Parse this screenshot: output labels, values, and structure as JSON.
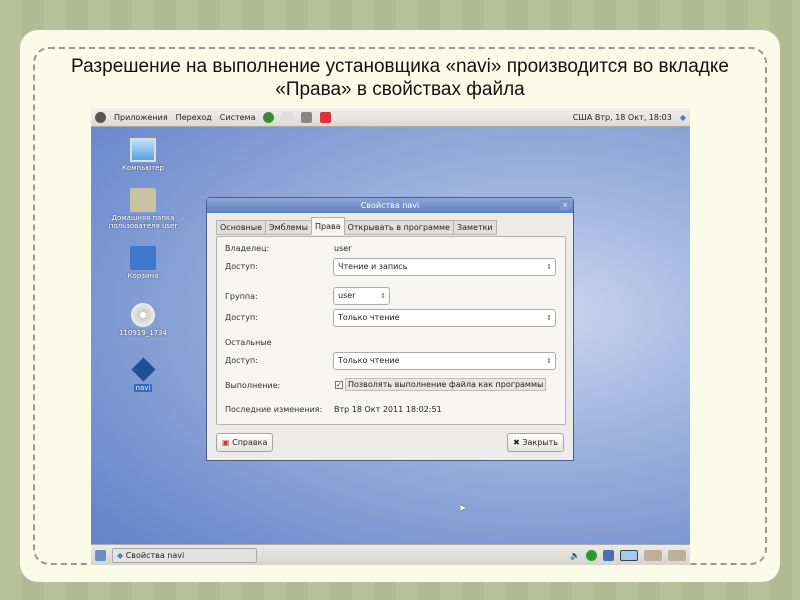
{
  "slide": {
    "title": "Разрешение на выполнение установщика «navi» производится во вкладке «Права» в свойствах файла"
  },
  "top_panel": {
    "menus": [
      "Приложения",
      "Переход",
      "Система"
    ],
    "clock": "США Втр, 18 Окт, 18:03"
  },
  "desktop_icons": [
    {
      "label": "Компьютер",
      "icon": "computer-icon"
    },
    {
      "label": "Домашняя папка пользователя user",
      "icon": "home-folder-icon"
    },
    {
      "label": "Корзина",
      "icon": "trash-icon"
    },
    {
      "label": "110919_1734",
      "icon": "cd-icon"
    },
    {
      "label": "navi",
      "icon": "installer-icon"
    }
  ],
  "dialog": {
    "title": "Свойства navi",
    "tabs": [
      "Основные",
      "Эмблемы",
      "Права",
      "Открывать в программе",
      "Заметки"
    ],
    "active_tab": "Права",
    "owner_label": "Владелец:",
    "owner_value": "user",
    "access_label": "Доступ:",
    "owner_access": "Чтение и запись",
    "group_label": "Группа:",
    "group_value": "user",
    "group_access": "Только чтение",
    "others_label": "Остальные",
    "others_access": "Только чтение",
    "exec_label": "Выполнение:",
    "exec_checkbox": "Позволять выполнение файла как программы",
    "exec_checked": true,
    "modified_label": "Последние изменения:",
    "modified_value": "Втр 18 Окт 2011 18:02:51",
    "help_button": "Справка",
    "close_button": "Закрыть"
  },
  "bottom_panel": {
    "task": "Свойства navi"
  }
}
